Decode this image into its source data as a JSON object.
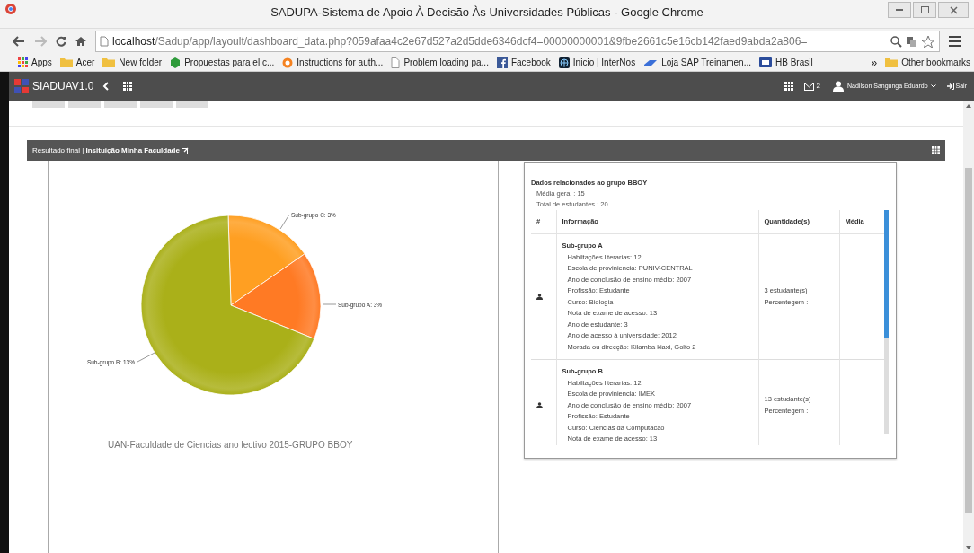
{
  "window": {
    "title": "SADUPA-Sistema de Apoio À Decisão Às Universidades Públicas - Google Chrome"
  },
  "browser": {
    "url_host": "localhost",
    "url_path": "/Sadup/app/layoult/dashboard_data.php?059afaa4c2e67d527a2d5dde6346dcf4=00000000001&9fbe2661c5e16cb142faed9abda2a806=",
    "bookmarks": [
      {
        "label": "Apps",
        "kind": "apps"
      },
      {
        "label": "Acer",
        "kind": "folder"
      },
      {
        "label": "New folder",
        "kind": "folder"
      },
      {
        "label": "Propuestas para el c...",
        "kind": "hexagon"
      },
      {
        "label": "Instructions for auth...",
        "kind": "swirl"
      },
      {
        "label": "Problem loading pa...",
        "kind": "page"
      },
      {
        "label": "Facebook",
        "kind": "facebook"
      },
      {
        "label": "Inicio | InterNos",
        "kind": "globe"
      },
      {
        "label": "Loja SAP Treinamen...",
        "kind": "link"
      },
      {
        "label": "HB Brasil",
        "kind": "badge"
      }
    ],
    "more": "»",
    "other_bookmarks": "Other bookmarks"
  },
  "app_bar": {
    "brand": "SIADUAV1.0",
    "messages": "2",
    "user": "Nadilson Sangunga Eduardo",
    "logout": "Sair"
  },
  "panel": {
    "header": "Resultado final | **Insituição Minha Faculdade**",
    "chart_data": {
      "type": "pie",
      "title": "UAN-Faculdade de Ciencias ano lectivo 2015-GRUPO BBOY",
      "categories": [
        "Sub-grupo C: 3%",
        "Sub-grupo A: 3%",
        "Sub-grupo B: 13%"
      ],
      "values": [
        3,
        3,
        13
      ]
    }
  },
  "details": {
    "title": "Dados relacionados ao grupo BBOY",
    "stats": [
      "Média geral : 15",
      "Total de estudantes : 20"
    ],
    "columns": [
      "#",
      "Informação",
      "Quantidade(s)",
      "Média"
    ],
    "rows": [
      {
        "name": "Sub-grupo A",
        "lines": [
          "Habiltações literarias: 12",
          "Escola de proviniencia: PUNIV-CENTRAL",
          "Ano de conclusão de ensino médio: 2007",
          "Profissão: Estudante",
          "Curso: Biologia",
          "Nota de exame de acesso: 13",
          "Ano de estudante: 3",
          "Ano de acesso à universidade: 2012",
          "Morada ou direcção: Kilamba kiaxi, Golfo 2"
        ],
        "quantity": "3 estudante(s)",
        "percentage": "Percentegem :"
      },
      {
        "name": "Sub-grupo B",
        "lines": [
          "Habiltações literarias: 12",
          "Escola de proviniencia: IMEK",
          "Ano de conclusão de ensino médio: 2007",
          "Profissão: Estudante",
          "Curso: Ciencias da Computacao",
          "Nota de exame de acesso: 13"
        ],
        "quantity": "13 estudante(s)",
        "percentage": "Percentegem :"
      }
    ]
  }
}
